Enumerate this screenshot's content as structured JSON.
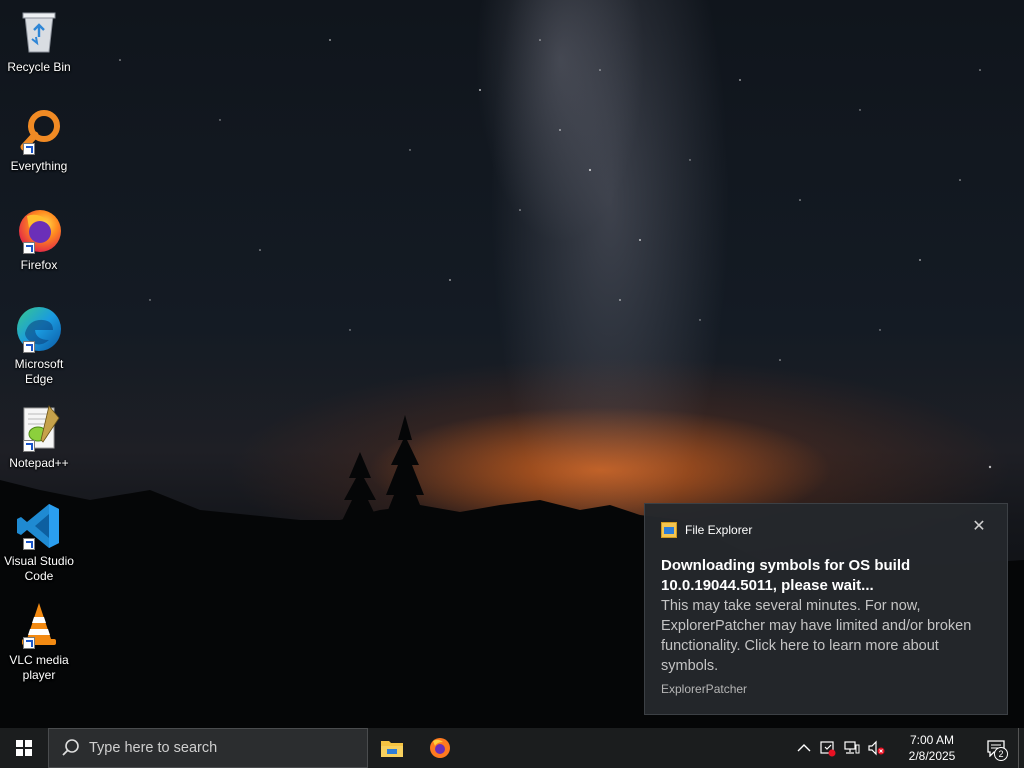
{
  "desktop": {
    "icons": [
      {
        "label": "Recycle Bin",
        "icon": "recycle-bin-icon"
      },
      {
        "label": "Everything",
        "icon": "everything-search-icon"
      },
      {
        "label": "Firefox",
        "icon": "firefox-icon"
      },
      {
        "label": "Microsoft\nEdge",
        "icon": "edge-icon"
      },
      {
        "label": "Notepad++",
        "icon": "notepad-plus-plus-icon"
      },
      {
        "label": "Visual Studio\nCode",
        "icon": "vscode-icon"
      },
      {
        "label": "VLC media\nplayer",
        "icon": "vlc-icon"
      }
    ]
  },
  "toast": {
    "app_name": "File Explorer",
    "title": "Downloading symbols for OS build 10.0.19044.5011, please wait...",
    "body": "This may take several minutes. For now, ExplorerPatcher may have limited and/or broken functionality. Click here to learn more about symbols.",
    "attribution": "ExplorerPatcher",
    "close_glyph": "✕"
  },
  "taskbar": {
    "search_placeholder": "Type here to search",
    "pinned_apps": [
      "file-explorer-icon",
      "firefox-icon"
    ],
    "clock": {
      "time": "7:00 AM",
      "date": "2/8/2025"
    },
    "notification_count": "2"
  },
  "colors": {
    "taskbar": "#1b1d1e",
    "toast_bg": "#24282c",
    "accent_orange": "#eb6e1e"
  }
}
